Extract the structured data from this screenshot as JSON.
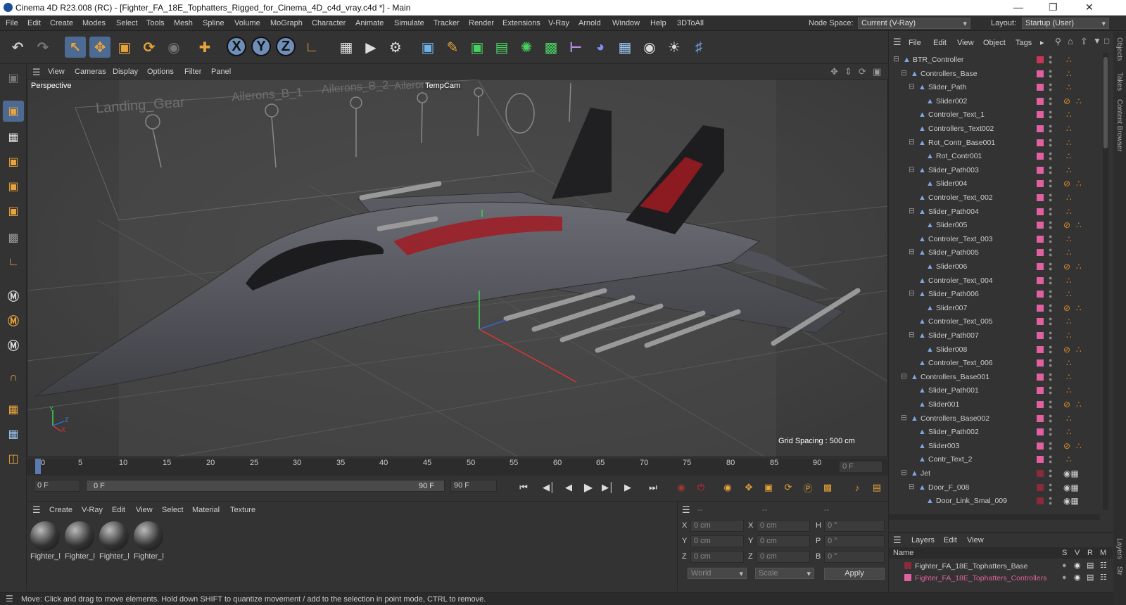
{
  "window": {
    "title": "Cinema 4D R23.008 (RC) - [Fighter_FA_18E_Tophatters_Rigged_for_Cinema_4D_c4d_vray.c4d *] - Main",
    "minimize": "—",
    "maximize": "❐",
    "close": "✕"
  },
  "menu": [
    "File",
    "Edit",
    "Create",
    "Modes",
    "Select",
    "Tools",
    "Mesh",
    "Spline",
    "Volume",
    "MoGraph",
    "Character",
    "Animate",
    "Simulate",
    "Tracker",
    "Render",
    "Extensions",
    "V-Ray",
    "Arnold",
    "Window",
    "Help",
    "3DToAll"
  ],
  "node_space": {
    "label": "Node Space:",
    "value": "Current (V-Ray)"
  },
  "layout": {
    "label": "Layout:",
    "value": "Startup (User)"
  },
  "toolbar_axis": [
    "X",
    "Y",
    "Z"
  ],
  "viewport": {
    "menu": [
      "View",
      "Cameras",
      "Display",
      "Options",
      "Filter",
      "Panel"
    ],
    "name": "Perspective",
    "camera": "TempCam",
    "grid_spacing": "Grid Spacing : 500 cm",
    "scene_labels": [
      "Landing_Gear",
      "Ailerons_B_1",
      "Ailerons_B_2",
      "Aileron"
    ],
    "axes": {
      "y": "Y",
      "z": "Z",
      "x": "X"
    }
  },
  "timeline": {
    "ticks": [
      "0",
      "5",
      "10",
      "15",
      "20",
      "25",
      "30",
      "35",
      "40",
      "45",
      "50",
      "55",
      "60",
      "65",
      "70",
      "75",
      "80",
      "85",
      "90"
    ],
    "current_frame": "0 F"
  },
  "transport": {
    "start": "0 F",
    "range_start": "0 F",
    "range_end": "90 F",
    "end": "90 F"
  },
  "materials": {
    "menu": [
      "Create",
      "V-Ray",
      "Edit",
      "View",
      "Select",
      "Material",
      "Texture"
    ],
    "items": [
      "Fighter_l",
      "Fighter_l",
      "Fighter_l",
      "Fighter_l"
    ]
  },
  "coords": {
    "header": [
      "--",
      "--",
      "--"
    ],
    "rows": [
      {
        "a": "X",
        "av": "0 cm",
        "b": "X",
        "bv": "0 cm",
        "c": "H",
        "cv": "0 °"
      },
      {
        "a": "Y",
        "av": "0 cm",
        "b": "Y",
        "bv": "0 cm",
        "c": "P",
        "cv": "0 °"
      },
      {
        "a": "Z",
        "av": "0 cm",
        "b": "Z",
        "bv": "0 cm",
        "c": "B",
        "cv": "0 °"
      }
    ],
    "space": "World",
    "mode": "Scale",
    "apply": "Apply"
  },
  "objects": {
    "menu": [
      "File",
      "Edit",
      "View",
      "Object",
      "Tags"
    ],
    "items": [
      {
        "name": "BTR_Controller",
        "level": 0,
        "expand": true,
        "color": "#c8365b",
        "tag": "light",
        "tag2": false
      },
      {
        "name": "Controllers_Base",
        "level": 1,
        "expand": true,
        "color": "#e060a0",
        "tag": "light",
        "tag2": false
      },
      {
        "name": "Slider_Path",
        "level": 2,
        "expand": true,
        "color": "#e060a0",
        "tag": "light",
        "tag2": false
      },
      {
        "name": "Slider002",
        "level": 3,
        "expand": false,
        "color": "#e060a0",
        "tag": "light",
        "tag2": true
      },
      {
        "name": "Controler_Text_1",
        "level": 2,
        "expand": false,
        "color": "#e060a0",
        "tag": "light",
        "tag2": false
      },
      {
        "name": "Controllers_Text002",
        "level": 2,
        "expand": false,
        "color": "#e060a0",
        "tag": "light",
        "tag2": false
      },
      {
        "name": "Rot_Contr_Base001",
        "level": 2,
        "expand": true,
        "color": "#e060a0",
        "tag": "light",
        "tag2": false
      },
      {
        "name": "Rot_Contr001",
        "level": 3,
        "expand": false,
        "color": "#e060a0",
        "tag": "light",
        "tag2": false
      },
      {
        "name": "Slider_Path003",
        "level": 2,
        "expand": true,
        "color": "#e060a0",
        "tag": "light",
        "tag2": false
      },
      {
        "name": "Slider004",
        "level": 3,
        "expand": false,
        "color": "#e060a0",
        "tag": "light",
        "tag2": true
      },
      {
        "name": "Controler_Text_002",
        "level": 2,
        "expand": false,
        "color": "#e060a0",
        "tag": "light",
        "tag2": false
      },
      {
        "name": "Slider_Path004",
        "level": 2,
        "expand": true,
        "color": "#e060a0",
        "tag": "light",
        "tag2": false
      },
      {
        "name": "Slider005",
        "level": 3,
        "expand": false,
        "color": "#e060a0",
        "tag": "light",
        "tag2": true
      },
      {
        "name": "Controler_Text_003",
        "level": 2,
        "expand": false,
        "color": "#e060a0",
        "tag": "light",
        "tag2": false
      },
      {
        "name": "Slider_Path005",
        "level": 2,
        "expand": true,
        "color": "#e060a0",
        "tag": "light",
        "tag2": false
      },
      {
        "name": "Slider006",
        "level": 3,
        "expand": false,
        "color": "#e060a0",
        "tag": "light",
        "tag2": true
      },
      {
        "name": "Controler_Text_004",
        "level": 2,
        "expand": false,
        "color": "#e060a0",
        "tag": "light",
        "tag2": false
      },
      {
        "name": "Slider_Path006",
        "level": 2,
        "expand": true,
        "color": "#e060a0",
        "tag": "light",
        "tag2": false
      },
      {
        "name": "Slider007",
        "level": 3,
        "expand": false,
        "color": "#e060a0",
        "tag": "light",
        "tag2": true
      },
      {
        "name": "Controler_Text_005",
        "level": 2,
        "expand": false,
        "color": "#e060a0",
        "tag": "light",
        "tag2": false
      },
      {
        "name": "Slider_Path007",
        "level": 2,
        "expand": true,
        "color": "#e060a0",
        "tag": "light",
        "tag2": false
      },
      {
        "name": "Slider008",
        "level": 3,
        "expand": false,
        "color": "#e060a0",
        "tag": "light",
        "tag2": true
      },
      {
        "name": "Controler_Text_006",
        "level": 2,
        "expand": false,
        "color": "#e060a0",
        "tag": "light",
        "tag2": false
      },
      {
        "name": "Controllers_Base001",
        "level": 1,
        "expand": true,
        "color": "#e060a0",
        "tag": "light",
        "tag2": false
      },
      {
        "name": "Slider_Path001",
        "level": 2,
        "expand": false,
        "color": "#e060a0",
        "tag": "light",
        "tag2": false
      },
      {
        "name": "Slider001",
        "level": 2,
        "expand": false,
        "color": "#e060a0",
        "tag": "light",
        "tag2": true
      },
      {
        "name": "Controllers_Base002",
        "level": 1,
        "expand": true,
        "color": "#e060a0",
        "tag": "light",
        "tag2": false
      },
      {
        "name": "Slider_Path002",
        "level": 2,
        "expand": false,
        "color": "#e060a0",
        "tag": "light",
        "tag2": false
      },
      {
        "name": "Slider003",
        "level": 2,
        "expand": false,
        "color": "#e060a0",
        "tag": "light",
        "tag2": true
      },
      {
        "name": "Contr_Text_2",
        "level": 2,
        "expand": false,
        "color": "#e060a0",
        "tag": "light",
        "tag2": false
      },
      {
        "name": "Jet",
        "level": 1,
        "expand": true,
        "color": "#8a2a3a",
        "tag": "mat",
        "tag2": false
      },
      {
        "name": "Door_F_008",
        "level": 2,
        "expand": true,
        "color": "#8a2a3a",
        "tag": "mat",
        "tag2": false
      },
      {
        "name": "Door_Link_Smal_009",
        "level": 3,
        "expand": false,
        "color": "#8a2a3a",
        "tag": "mat",
        "tag2": false
      }
    ]
  },
  "layers": {
    "menu": [
      "Layers",
      "Edit",
      "View"
    ],
    "columns": [
      "Name",
      "S",
      "V",
      "R",
      "M"
    ],
    "items": [
      {
        "name": "Fighter_FA_18E_Tophatters_Base",
        "color": "#8a2a3a",
        "text_color": "#cccccc"
      },
      {
        "name": "Fighter_FA_18E_Tophatters_Controllers",
        "color": "#e060a0",
        "text_color": "#e060a0"
      }
    ]
  },
  "side_tabs": [
    "Objects",
    "Takes",
    "Content Browser",
    "Layers",
    "Str"
  ],
  "status": "Move: Click and drag to move elements. Hold down SHIFT to quantize movement / add to the selection in point mode, CTRL to remove."
}
